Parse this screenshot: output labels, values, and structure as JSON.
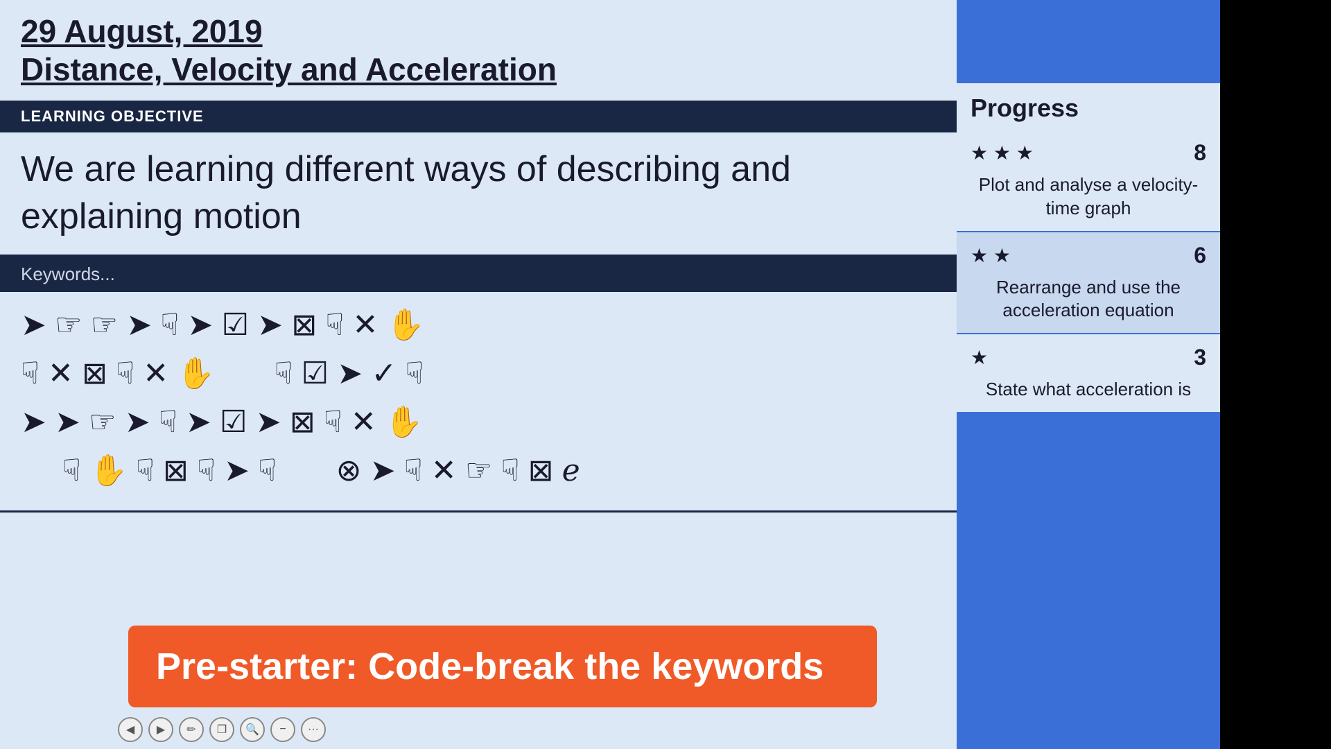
{
  "header": {
    "date": "29 August, 2019",
    "subject": "Distance, Velocity and Acceleration"
  },
  "learning_objective_label": "LEARNING OBJECTIVE",
  "learning_objective_text": "We are learning different ways of describing and explaining motion",
  "keywords_label": "Keywords...",
  "symbol_rows": [
    "➤☞☞➤☟➤☑➤⊠☟✕✋",
    "☟✕⊠☟✕✋    ☟☑➤✓☟",
    "➤➤☞➤☟➤☑➤⊠☟✕✋",
    "    ☟✋☟⊠☟➤☟    ⊗➤☟✕☞☟⊠ℯ"
  ],
  "prestarter": {
    "text": "Pre-starter: Code-break the keywords"
  },
  "toolbar": {
    "prev": "◀",
    "next": "▶",
    "edit": "✏",
    "copy": "❐",
    "search": "🔍",
    "minus": "−",
    "more": "···"
  },
  "progress": {
    "title": "Progress",
    "items": [
      {
        "stars": "★ ★ ★",
        "score": "8",
        "desc": "Plot and analyse a velocity-time graph"
      },
      {
        "stars": "★ ★",
        "score": "6",
        "desc": "Rearrange and use the acceleration equation"
      },
      {
        "stars": "★",
        "score": "3",
        "desc": "State what acceleration is"
      }
    ]
  }
}
